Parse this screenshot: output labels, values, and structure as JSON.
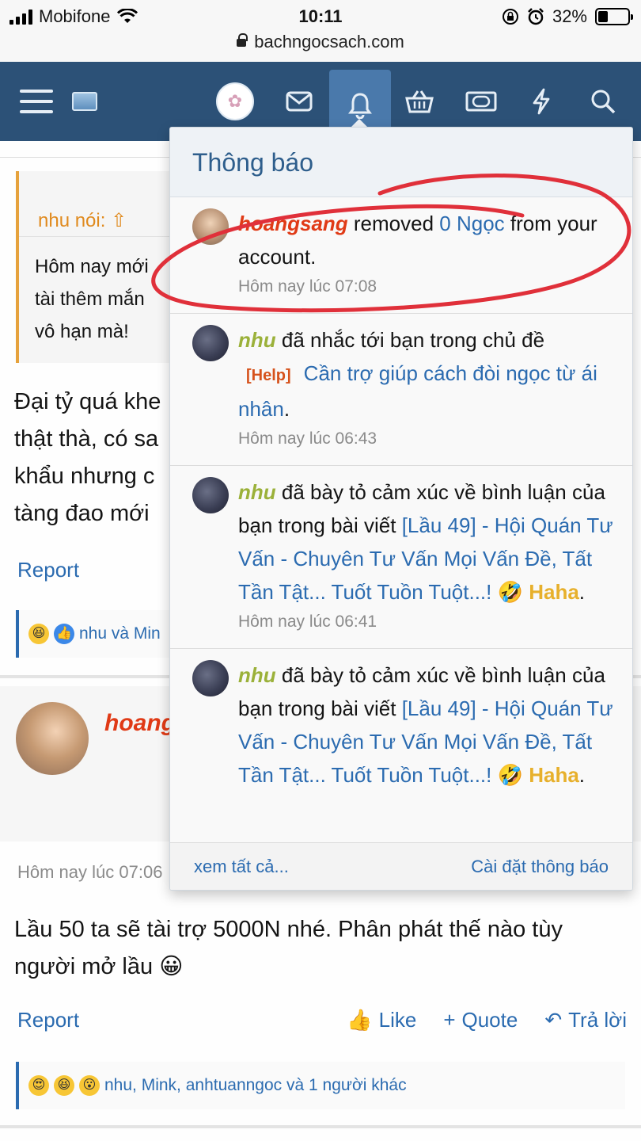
{
  "status_bar": {
    "carrier": "Mobifone",
    "time": "10:11",
    "battery": "32%",
    "battery_level": 0.32,
    "url": "bachngocsach.com"
  },
  "nav": {
    "icons": [
      "menu-icon",
      "logo-icon",
      "avatar",
      "mail-icon",
      "bell-icon",
      "basket-icon",
      "money-icon",
      "lightning-icon",
      "search-icon"
    ],
    "active": "bell-icon",
    "colors": {
      "bar": "#2c5177",
      "active": "#4a79ab"
    }
  },
  "background": {
    "quote_author": "nhu nói:",
    "quote_text": [
      "Hôm nay mới",
      "tài thêm mắn",
      "vô hạn mà!"
    ],
    "post_text": [
      "Đại tỷ quá khe",
      "thật thà, có sa",
      "khẩu nhưng c",
      "tàng đao mới"
    ],
    "report": "Report",
    "reactions_1": "nhu và Min",
    "post2_author": "hoang",
    "post2_time": "Hôm nay lúc 07:06",
    "post2_text": "Lầu 50 ta sẽ tài trợ 5000N nhé. Phân phát thế nào tùy người mở lầu",
    "post2_emoji": "😀",
    "like": "Like",
    "quote": "Quote",
    "reply": "Trả lời",
    "reactions_2": "nhu, Mink, anhtuanngoc và 1 người khác"
  },
  "popup": {
    "title": "Thông báo",
    "notifications": [
      {
        "user": "hoangsang",
        "text_a": " removed ",
        "link": "0 Ngọc",
        "text_b": " from your account.",
        "time": "Hôm nay lúc 07:08"
      },
      {
        "user": "nhu",
        "text_a": " đã nhắc tới bạn trong chủ đề",
        "tag": "[Help]",
        "link": "Cần trợ giúp cách đòi ngọc từ ái nhân",
        "text_b": ".",
        "time": "Hôm nay lúc 06:43"
      },
      {
        "user": "nhu",
        "text_a": " đã bày tỏ cảm xúc về bình luận của bạn trong bài viết ",
        "link": "[Lầu 49] - Hội Quán Tư Vấn - Chuyên Tư Vấn Mọi Vấn Đề, Tất Tần Tật... Tuốt Tuồn Tuột...!",
        "emoji": "🤣",
        "reaction": "Haha",
        "text_b": ".",
        "time": "Hôm nay lúc 06:41"
      },
      {
        "user": "nhu",
        "text_a": " đã bày tỏ cảm xúc về bình luận của bạn trong bài viết ",
        "link": "[Lầu 49] - Hội Quán Tư Vấn - Chuyên Tư Vấn Mọi Vấn Đề, Tất Tần Tật... Tuốt Tuồn Tuột...!",
        "emoji": "🤣",
        "reaction": "Haha",
        "text_b": "."
      }
    ],
    "see_all": "xem tất cả...",
    "settings": "Cài đặt thông báo"
  }
}
